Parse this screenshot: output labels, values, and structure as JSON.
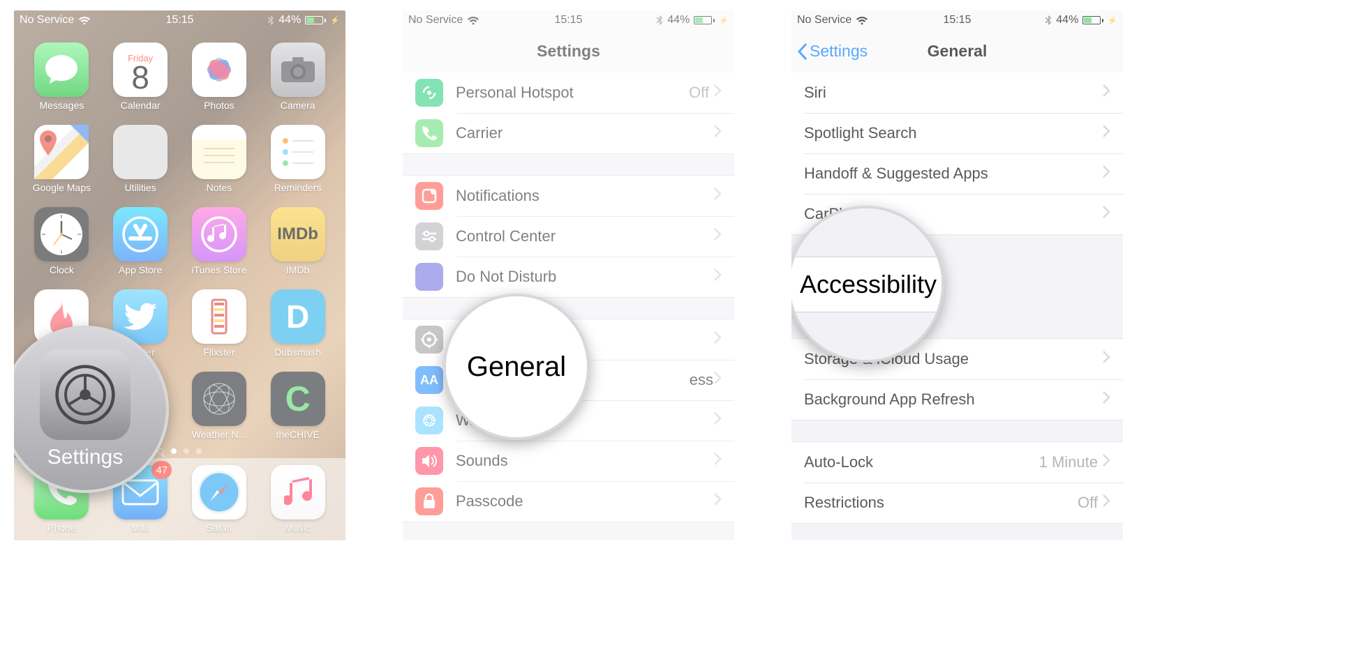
{
  "status_bar": {
    "carrier": "No Service",
    "time": "15:15",
    "battery_pct": "44%",
    "battery_fill_pct": 44
  },
  "screen1": {
    "calendar": {
      "day_of_week": "Friday",
      "day_num": "8"
    },
    "apps": {
      "messages": "Messages",
      "calendar": "Calendar",
      "photos": "Photos",
      "camera": "Camera",
      "gmaps": "Google Maps",
      "utilities": "Utilities",
      "notes": "Notes",
      "reminders": "Reminders",
      "clock": "Clock",
      "appstore": "App Store",
      "itunes": "iTunes Store",
      "imdb": "IMDb",
      "tinder": "tter",
      "twitter": "Twitter",
      "flixster": "Flixster",
      "dubsmash": "Dubsmash",
      "settings": "Settings",
      "weather": "Weather N...",
      "chive": "theCHIVE"
    },
    "imdb_icon_text": "IMDb",
    "dock": {
      "phone": "Phone",
      "mail": "Mail",
      "safari": "Safari",
      "music": "Music"
    },
    "mail_badge": "47",
    "magnify_label": "Settings"
  },
  "screen2": {
    "nav_title": "Settings",
    "rows": {
      "hotspot": {
        "label": "Personal Hotspot",
        "detail": "Off"
      },
      "carrier": {
        "label": "Carrier"
      },
      "notifications": {
        "label": "Notifications"
      },
      "controlcenter": {
        "label": "Control Center"
      },
      "dnd": {
        "label": "Do Not Disturb"
      },
      "general": {
        "label": "General"
      },
      "display": {
        "label": "ess"
      },
      "wallpaper": {
        "label": "Wallpaper"
      },
      "sounds": {
        "label": "Sounds"
      },
      "passcode": {
        "label": "Passcode"
      }
    },
    "magnify_text": "General"
  },
  "screen3": {
    "nav_back": "Settings",
    "nav_title": "General",
    "rows": {
      "siri": "Siri",
      "spotlight": "Spotlight Search",
      "handoff": "Handoff & Suggested Apps",
      "carplay": "CarPlay",
      "storage": "Storage & iCloud Usage",
      "bgrefresh": "Background App Refresh",
      "autolock": {
        "label": "Auto-Lock",
        "detail": "1 Minute"
      },
      "restrictions": {
        "label": "Restrictions",
        "detail": "Off"
      }
    },
    "magnify_text": "Accessibility"
  }
}
